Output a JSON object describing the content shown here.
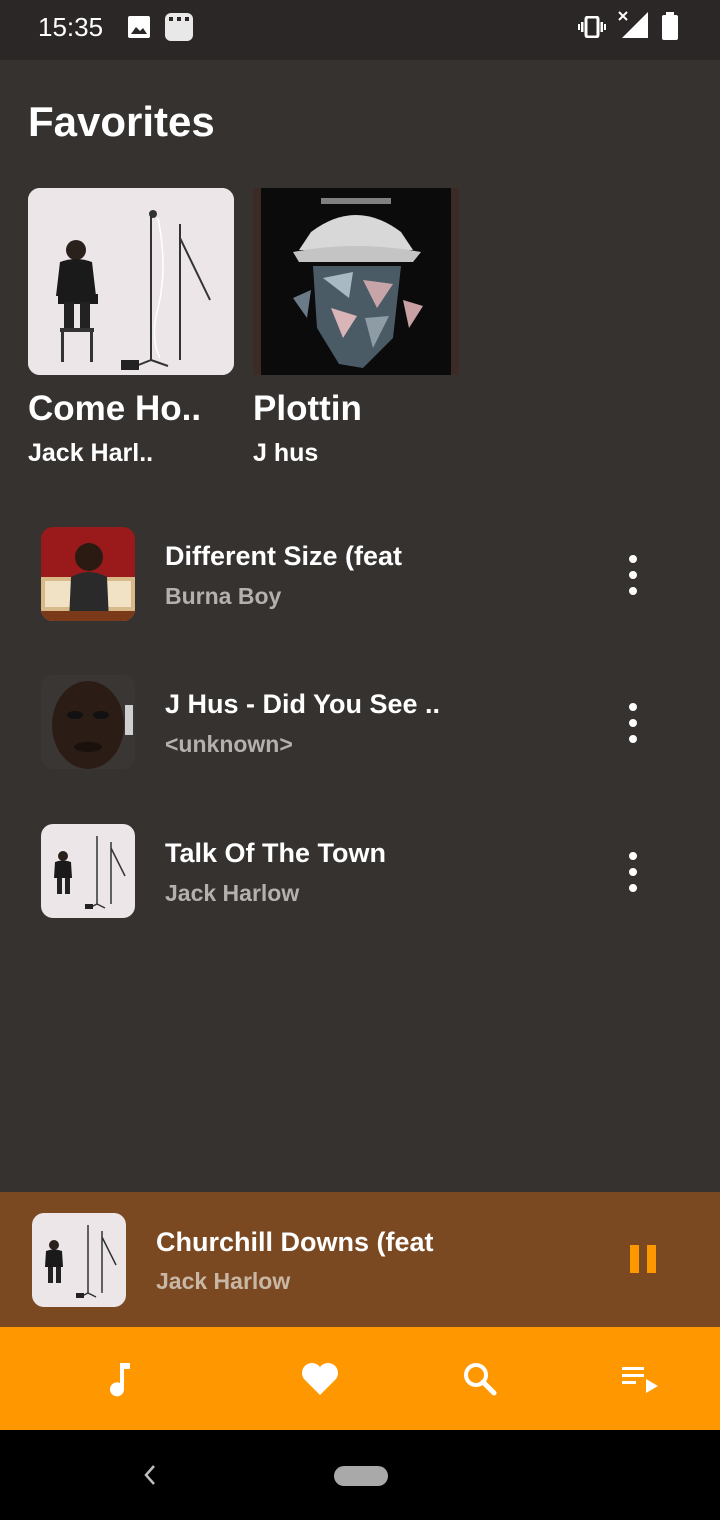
{
  "status_bar": {
    "time": "15:35",
    "icons": [
      "image-icon",
      "clapperboard-icon",
      "vibrate-icon",
      "signal-no-data-icon",
      "battery-icon"
    ]
  },
  "page": {
    "title": "Favorites"
  },
  "favorites": [
    {
      "title": "Come Ho..",
      "artist": "Jack Harl..",
      "art": "jack-harlow-cover",
      "art_bg": "#ece6e8"
    },
    {
      "title": "Plottin",
      "artist": "J hus",
      "art": "j-hus-common-sense-cover",
      "art_bg": "#0b0b0c"
    }
  ],
  "tracks": [
    {
      "title": "Different Size (feat",
      "artist": "Burna Boy",
      "art": "burna-boy-cover"
    },
    {
      "title": "J Hus - Did You See ..",
      "artist": "<unknown>",
      "art": "j-hus-portrait"
    },
    {
      "title": "Talk Of The Town",
      "artist": "Jack Harlow",
      "art": "jack-harlow-cover"
    }
  ],
  "now_playing": {
    "title": "Churchill Downs (feat",
    "artist": "Jack Harlow",
    "art": "jack-harlow-cover",
    "state_icon": "pause-icon"
  },
  "bottom_nav": [
    {
      "icon": "music-note-icon"
    },
    {
      "icon": "heart-icon"
    },
    {
      "icon": "search-icon"
    },
    {
      "icon": "queue-play-icon"
    }
  ],
  "system_nav": {
    "icons": [
      "back-icon",
      "home-pill-icon"
    ]
  },
  "colors": {
    "background": "#363230",
    "status_bar": "#2a2726",
    "now_playing_bg": "#7a4821",
    "accent": "#ff9800",
    "secondary_text": "#b3b0ae"
  }
}
